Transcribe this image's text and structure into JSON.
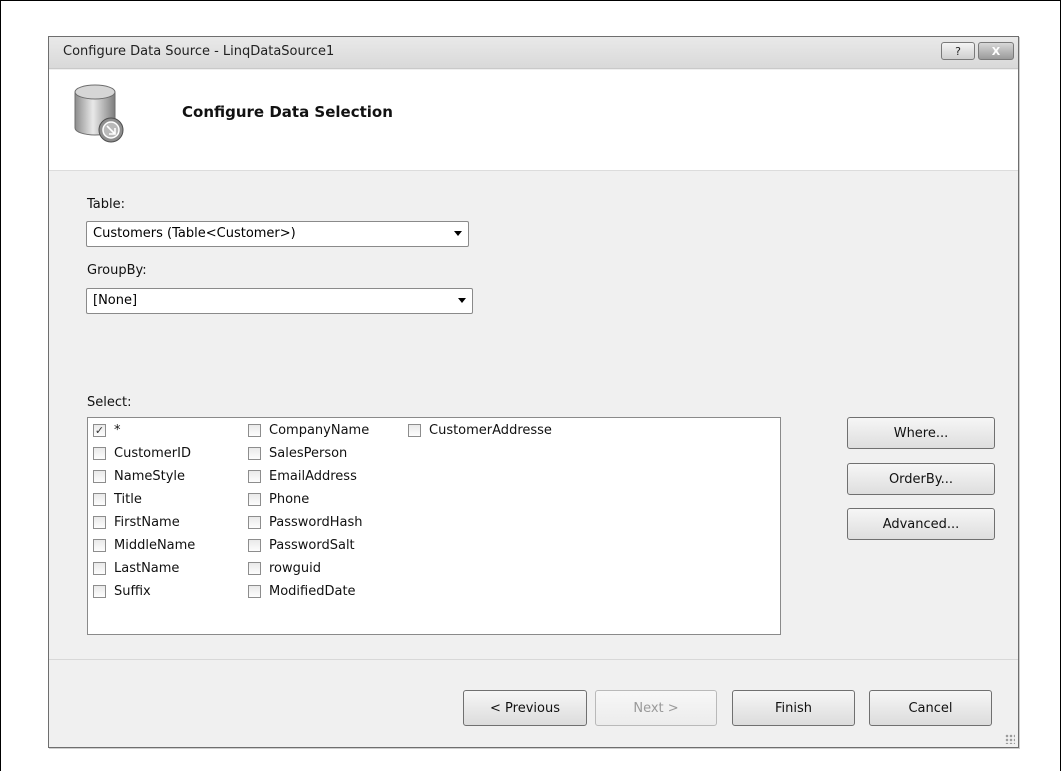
{
  "window": {
    "title": "Configure Data Source - LinqDataSource1",
    "help_label": "?",
    "close_label": "X"
  },
  "header": {
    "title": "Configure Data Selection",
    "icon": "database-icon"
  },
  "table": {
    "label": "Table:",
    "value": "Customers (Table<Customer>)"
  },
  "groupby": {
    "label": "GroupBy:",
    "value": "[None]"
  },
  "select": {
    "label": "Select:",
    "columns": [
      [
        {
          "label": "*",
          "checked": true
        },
        {
          "label": "CustomerID",
          "checked": false
        },
        {
          "label": "NameStyle",
          "checked": false
        },
        {
          "label": "Title",
          "checked": false
        },
        {
          "label": "FirstName",
          "checked": false
        },
        {
          "label": "MiddleName",
          "checked": false
        },
        {
          "label": "LastName",
          "checked": false
        },
        {
          "label": "Suffix",
          "checked": false
        }
      ],
      [
        {
          "label": "CompanyName",
          "checked": false
        },
        {
          "label": "SalesPerson",
          "checked": false
        },
        {
          "label": "EmailAddress",
          "checked": false
        },
        {
          "label": "Phone",
          "checked": false
        },
        {
          "label": "PasswordHash",
          "checked": false
        },
        {
          "label": "PasswordSalt",
          "checked": false
        },
        {
          "label": "rowguid",
          "checked": false
        },
        {
          "label": "ModifiedDate",
          "checked": false
        }
      ],
      [
        {
          "label": "CustomerAddresse",
          "checked": false
        }
      ]
    ]
  },
  "side_buttons": {
    "where": "Where...",
    "orderby": "OrderBy...",
    "advanced": "Advanced..."
  },
  "footer": {
    "previous": "< Previous",
    "next": "Next >",
    "finish": "Finish",
    "cancel": "Cancel"
  }
}
